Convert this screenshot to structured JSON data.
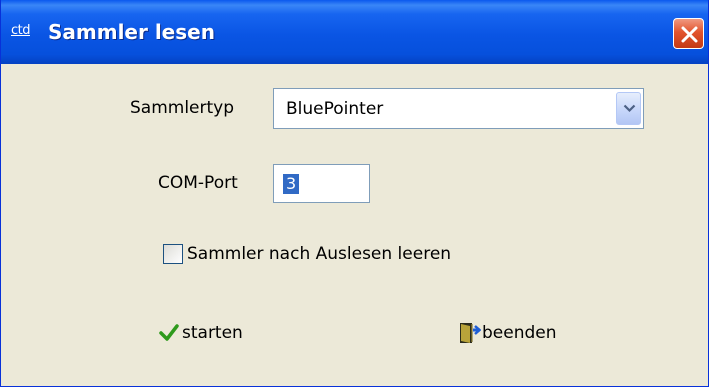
{
  "window": {
    "title": "Sammler lesen",
    "app_icon_text": "ctd"
  },
  "form": {
    "sammlertyp_label": "Sammlertyp",
    "sammlertyp_value": "BluePointer",
    "comport_label": "COM-Port",
    "comport_value": "3",
    "clear_checkbox_label": "Sammler nach Auslesen leeren",
    "clear_checkbox_checked": false
  },
  "buttons": {
    "start_label": "starten",
    "start_icon": "checkmark-icon",
    "end_label": "beenden",
    "end_icon": "exit-door-icon"
  },
  "colors": {
    "titlebar": "#0a55e4",
    "dialog_bg": "#ECE9D8",
    "selection": "#316ac5",
    "close_button": "#e2542d",
    "check_green": "#2e9a1c"
  }
}
